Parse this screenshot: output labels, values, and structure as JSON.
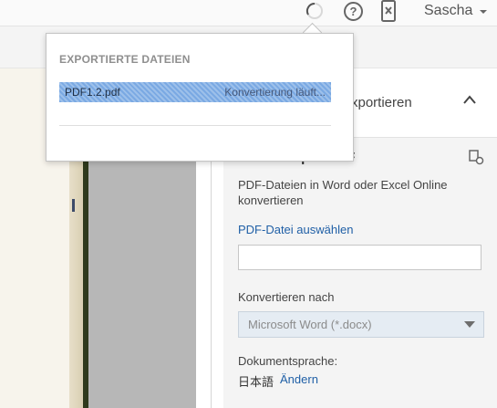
{
  "header": {
    "user_name": "Sascha",
    "icons": [
      "spinner-icon",
      "help-icon",
      "device-icon",
      "chevron-down-icon"
    ]
  },
  "popup": {
    "heading": "EXPORTIERTE DATEIEN",
    "files": [
      {
        "name": "PDF1.2.pdf",
        "status": "Konvertierung läuft..."
      }
    ]
  },
  "panel": {
    "header_title": "xportieren",
    "title": "Adobe ExportPDF",
    "description": "PDF-Dateien in Word oder Excel Online konvertieren",
    "select_link": "PDF-Datei auswählen",
    "file_input_value": "",
    "convert_label": "Konvertieren nach",
    "format_value": "Microsoft Word (*.docx)",
    "language_label": "Dokumentsprache:",
    "language_value": "日本語",
    "change_link": "Ändern"
  },
  "colors": {
    "link": "#1f5fa6",
    "highlight": "#7aa9e3",
    "panel_bg": "#f4f4f4"
  }
}
